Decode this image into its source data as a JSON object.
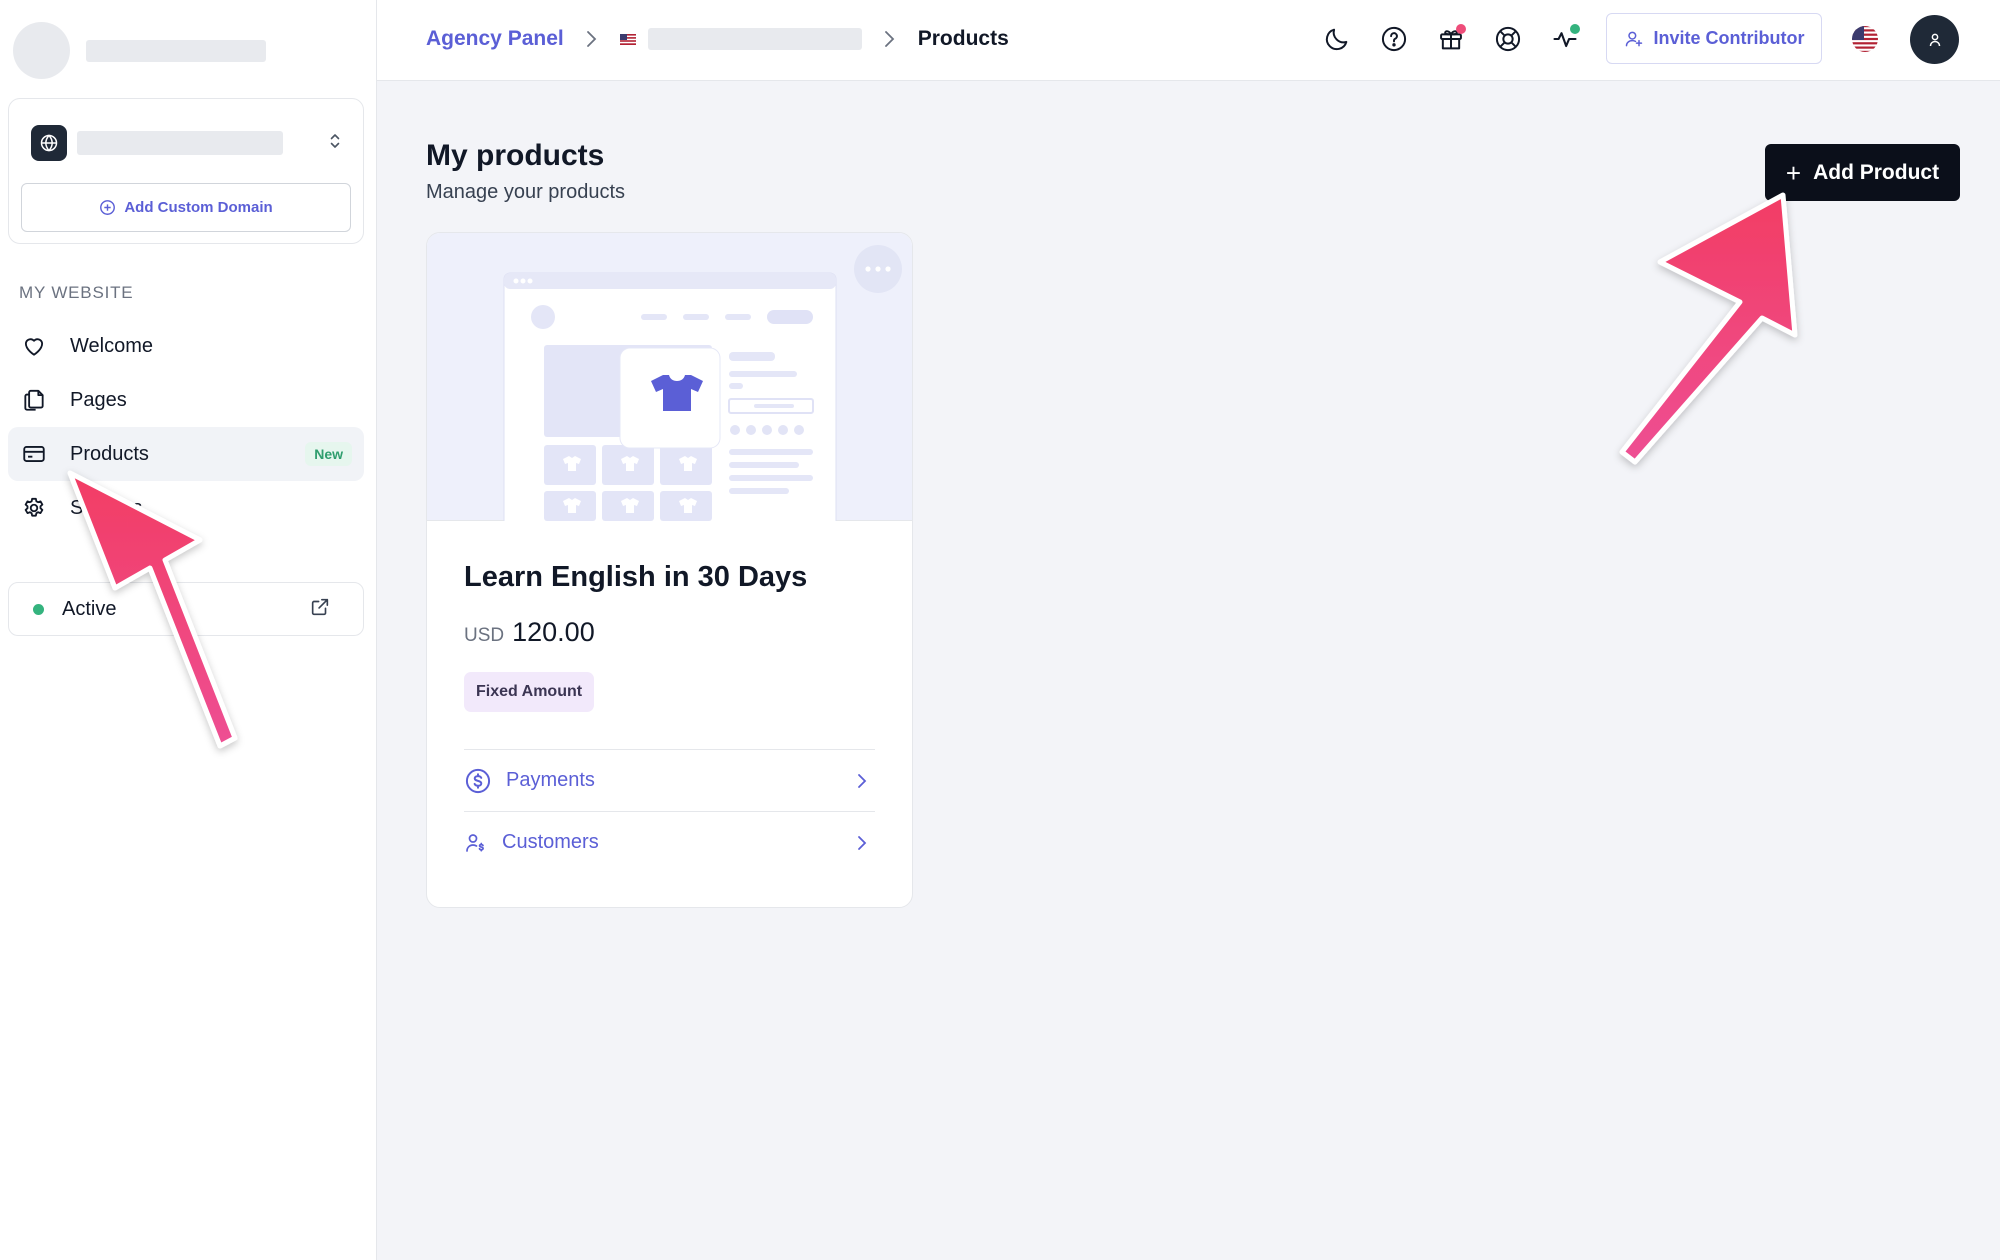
{
  "sidebar": {
    "add_domain_label": "Add Custom Domain",
    "section_label": "MY WEBSITE",
    "items": [
      {
        "label": "Welcome",
        "icon": "heart-icon"
      },
      {
        "label": "Pages",
        "icon": "pages-icon"
      },
      {
        "label": "Products",
        "icon": "card-icon",
        "badge": "New",
        "active": true
      },
      {
        "label": "Settings",
        "icon": "gear-icon"
      }
    ],
    "status_label": "Active"
  },
  "header": {
    "breadcrumb": {
      "root": "Agency Panel",
      "current": "Products"
    },
    "invite_label": "Invite Contributor",
    "icons": [
      "moon-icon",
      "help-icon",
      "gift-icon",
      "support-icon",
      "activity-icon",
      "flag-us-icon",
      "user-icon"
    ]
  },
  "main": {
    "title": "My products",
    "subtitle": "Manage your products",
    "add_product_label": "Add Product",
    "product": {
      "title": "Learn English in 30 Days",
      "currency": "USD",
      "amount": "120.00",
      "tag": "Fixed Amount",
      "links": [
        {
          "label": "Payments",
          "icon": "dollar-circle-icon"
        },
        {
          "label": "Customers",
          "icon": "customers-icon"
        }
      ]
    }
  },
  "colors": {
    "accent": "#5b5fd6",
    "arrow": "#f0457a",
    "status_green": "#34b37e",
    "badge_red": "#ee4d7a"
  }
}
